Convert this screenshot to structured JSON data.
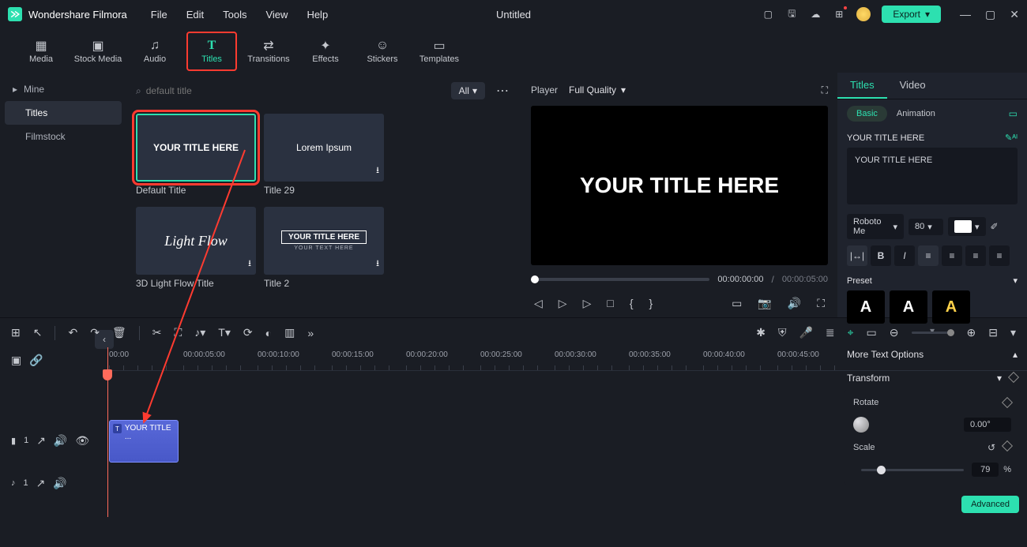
{
  "app_name": "Wondershare Filmora",
  "project_title": "Untitled",
  "menu": [
    "File",
    "Edit",
    "Tools",
    "View",
    "Help"
  ],
  "export_label": "Export",
  "main_tabs": [
    {
      "label": "Media",
      "icon": "▦"
    },
    {
      "label": "Stock Media",
      "icon": "▣"
    },
    {
      "label": "Audio",
      "icon": "♫"
    },
    {
      "label": "Titles",
      "icon": "T"
    },
    {
      "label": "Transitions",
      "icon": "⇄"
    },
    {
      "label": "Effects",
      "icon": "✦"
    },
    {
      "label": "Stickers",
      "icon": "☺"
    },
    {
      "label": "Templates",
      "icon": "▭"
    }
  ],
  "sidebar": {
    "mine": "Mine",
    "titles": "Titles",
    "filmstock": "Filmstock"
  },
  "search_placeholder": "default title",
  "all_label": "All",
  "thumbs": [
    {
      "text": "YOUR TITLE HERE",
      "caption": "Default Title"
    },
    {
      "text": "Lorem Ipsum",
      "caption": "Title 29"
    },
    {
      "text": "Light Flow",
      "caption": "3D Light Flow Title"
    },
    {
      "text": "YOUR TITLE HERE",
      "caption": "Title 2"
    }
  ],
  "player": {
    "label": "Player",
    "quality": "Full Quality",
    "preview_text": "YOUR TITLE HERE",
    "cur": "00:00:00:00",
    "total": "00:00:05:00"
  },
  "inspector": {
    "tabs": [
      "Titles",
      "Video"
    ],
    "sub": {
      "basic": "Basic",
      "animation": "Animation"
    },
    "section_title": "YOUR TITLE HERE",
    "text": "YOUR TITLE HERE",
    "font": "Roboto Me",
    "size": "80",
    "preset_label": "Preset",
    "more": "More Text Options",
    "transform": "Transform",
    "rotate": {
      "label": "Rotate",
      "value": "0.00°"
    },
    "scale": {
      "label": "Scale",
      "value": "79",
      "unit": "%"
    },
    "advanced": "Advanced"
  },
  "ruler": [
    "00:00",
    "00:00:05:00",
    "00:00:10:00",
    "00:00:15:00",
    "00:00:20:00",
    "00:00:25:00",
    "00:00:30:00",
    "00:00:35:00",
    "00:00:40:00",
    "00:00:45:00"
  ],
  "clip_label": "YOUR TITLE ...",
  "track_v": "1",
  "track_a": "1"
}
